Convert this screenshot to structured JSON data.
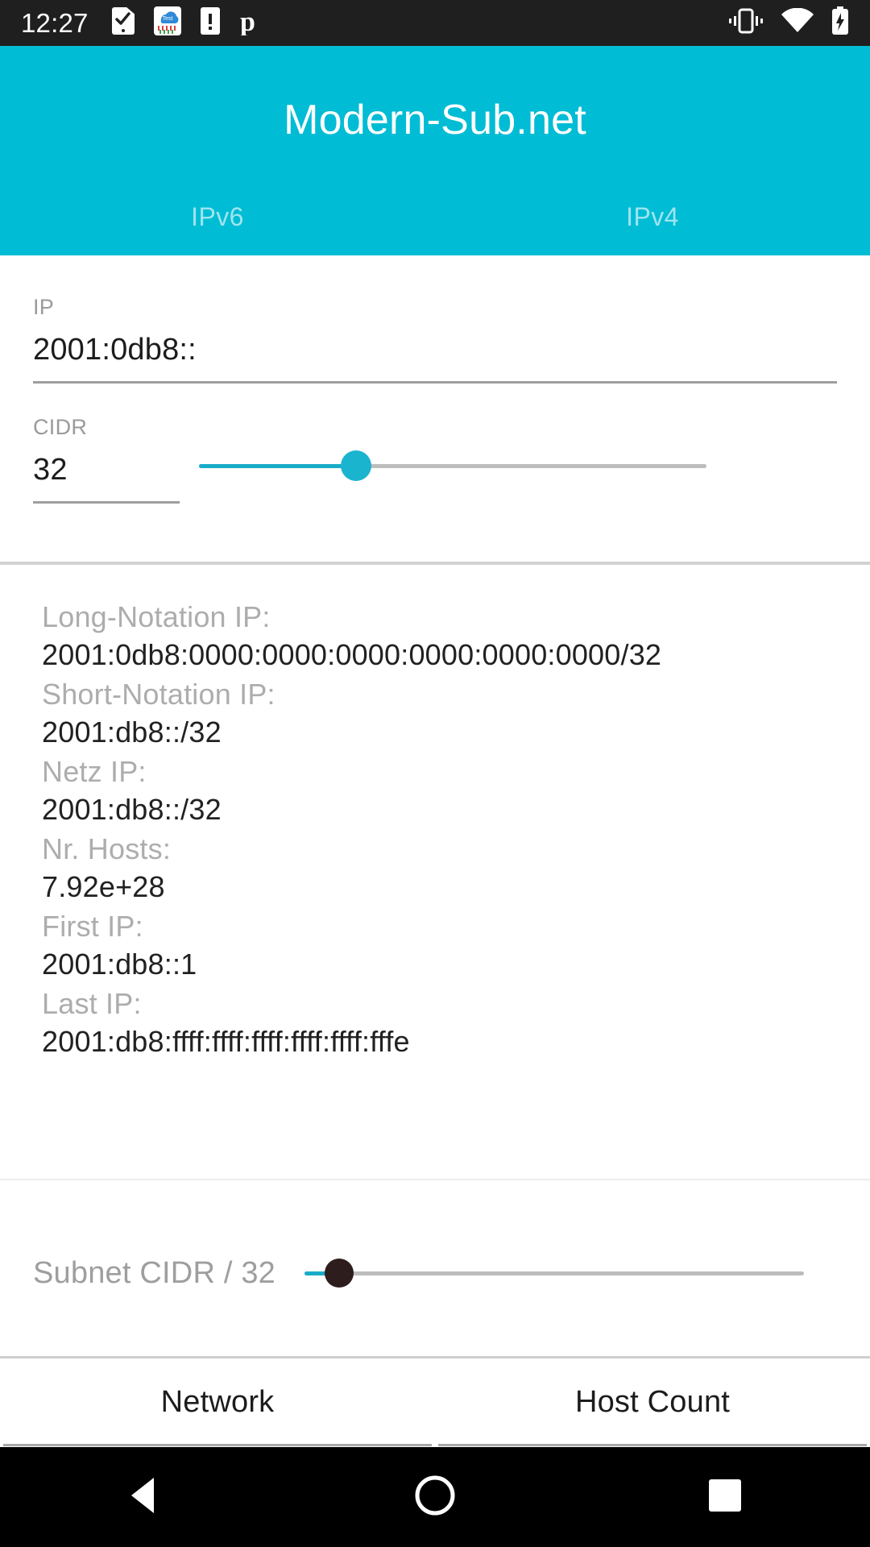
{
  "statusbar": {
    "clock": "12:27",
    "left_icons": [
      {
        "name": "phone-check-icon"
      },
      {
        "name": "weather-cloud-test-icon"
      },
      {
        "name": "phone-alert-icon"
      },
      {
        "name": "parking-p-icon"
      }
    ],
    "right_icons": [
      {
        "name": "vibrate-icon"
      },
      {
        "name": "wifi-icon"
      },
      {
        "name": "battery-charging-icon"
      }
    ]
  },
  "appbar": {
    "title": "Modern-Sub.net",
    "accent_color": "#00bcd4",
    "tabs": [
      {
        "label": "IPv6",
        "active": true
      },
      {
        "label": "IPv4",
        "active": false
      }
    ]
  },
  "form": {
    "ip": {
      "label": "IP",
      "value": "2001:0db8::"
    },
    "cidr": {
      "label": "CIDR",
      "value": "32",
      "slider_value": 32,
      "slider_min": 0,
      "slider_max": 128
    }
  },
  "results": [
    {
      "label": "Long-Notation IP:",
      "value": "2001:0db8:0000:0000:0000:0000:0000:0000/32"
    },
    {
      "label": "Short-Notation IP:",
      "value": "2001:db8::/32"
    },
    {
      "label": "Netz IP:",
      "value": "2001:db8::/32"
    },
    {
      "label": "Nr. Hosts:",
      "value": "7.92e+28"
    },
    {
      "label": "First IP:",
      "value": "2001:db8::1"
    },
    {
      "label": "Last IP:",
      "value": "2001:db8:ffff:ffff:ffff:ffff:ffff:fffe"
    }
  ],
  "subnet": {
    "label": "Subnet CIDR / 32",
    "slider_value": 32
  },
  "bottom_tabs": [
    {
      "label": "Network",
      "active": true
    },
    {
      "label": "Host Count",
      "active": false
    }
  ],
  "navbar": {
    "back": "back-icon",
    "home": "home-icon",
    "recents": "recents-icon"
  }
}
